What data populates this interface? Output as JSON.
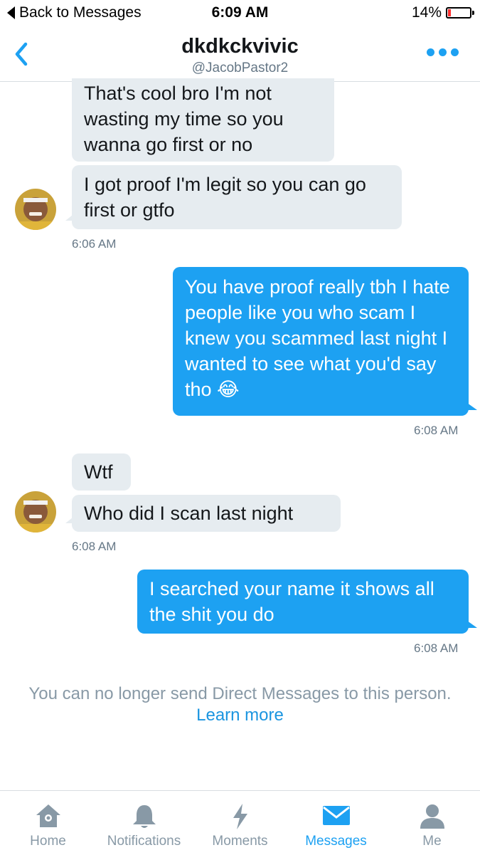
{
  "status_bar": {
    "back_label": "Back to Messages",
    "time": "6:09 AM",
    "battery_percent": "14%",
    "battery_level": 0.14
  },
  "header": {
    "name": "dkdkckvivic",
    "handle": "@JacobPastor2",
    "back_icon": "chevron-left-icon",
    "more_icon": "more-dots-icon"
  },
  "messages": [
    {
      "side": "in",
      "text": "That's cool bro I'm not wasting my time so you wanna go first or no"
    },
    {
      "side": "in",
      "text": "I got proof I'm legit so you can go first or gtfo"
    },
    {
      "side": "in",
      "timestamp": "6:06 AM"
    },
    {
      "side": "out",
      "text": "You have proof really tbh I hate people like you who scam I knew you scammed last night I wanted to see what you'd say tho 😂",
      "timestamp": "6:08 AM"
    },
    {
      "side": "in",
      "text": "Wtf"
    },
    {
      "side": "in",
      "text": "Who did I scan last night",
      "timestamp": "6:08 AM"
    },
    {
      "side": "out",
      "text": "I searched your name it shows all the shit you do",
      "timestamp": "6:08 AM"
    }
  ],
  "notice": {
    "text": "You can no longer send Direct Messages to this person.",
    "link": "Learn more"
  },
  "tabs": [
    {
      "label": "Home",
      "icon": "home-icon",
      "active": false
    },
    {
      "label": "Notifications",
      "icon": "bell-icon",
      "active": false
    },
    {
      "label": "Moments",
      "icon": "lightning-icon",
      "active": false
    },
    {
      "label": "Messages",
      "icon": "envelope-icon",
      "active": true
    },
    {
      "label": "Me",
      "icon": "person-icon",
      "active": false
    }
  ],
  "colors": {
    "accent": "#1da1f2",
    "incoming_bubble": "#e6ecf0",
    "muted_text": "#657786",
    "battery_low": "#ff2d2d"
  }
}
